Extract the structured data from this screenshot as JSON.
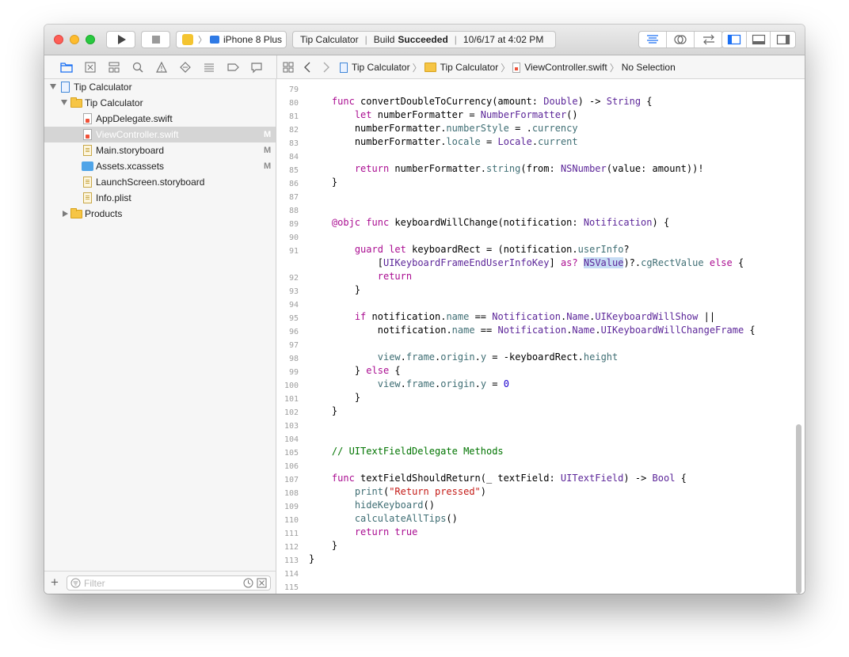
{
  "toolbar": {
    "scheme_device": "iPhone 8 Plus",
    "activity_app": "Tip Calculator",
    "build_prefix": "Build",
    "build_status": "Succeeded",
    "build_time": "10/6/17 at 4:02 PM"
  },
  "colors": {
    "close": "#fe5f57",
    "minimize": "#febc2e",
    "zoom": "#28c840",
    "accent": "#1a6ff4"
  },
  "jumpbar": {
    "crumbs": [
      "Tip Calculator",
      "Tip Calculator",
      "ViewController.swift",
      "No Selection"
    ]
  },
  "navigator": {
    "items": [
      {
        "label": "Tip Calculator",
        "icon": "project-icon",
        "badge": ""
      },
      {
        "label": "Tip Calculator",
        "icon": "folder-icon",
        "badge": ""
      },
      {
        "label": "AppDelegate.swift",
        "icon": "swift-file-icon",
        "badge": ""
      },
      {
        "label": "ViewController.swift",
        "icon": "swift-file-icon",
        "badge": "M"
      },
      {
        "label": "Main.storyboard",
        "icon": "storyboard-file-icon",
        "badge": "M"
      },
      {
        "label": "Assets.xcassets",
        "icon": "assets-icon",
        "badge": "M"
      },
      {
        "label": "LaunchScreen.storyboard",
        "icon": "storyboard-file-icon",
        "badge": ""
      },
      {
        "label": "Info.plist",
        "icon": "plist-file-icon",
        "badge": ""
      },
      {
        "label": "Products",
        "icon": "folder-icon",
        "badge": ""
      }
    ],
    "filter_placeholder": "Filter"
  },
  "editor": {
    "line_numbers": [
      "79",
      "80",
      "81",
      "82",
      "83",
      "84",
      "85",
      "86",
      "87",
      "88",
      "89",
      "90",
      "91",
      "",
      "92",
      "93",
      "94",
      "95",
      "96",
      "97",
      "98",
      "99",
      "100",
      "101",
      "102",
      "103",
      "104",
      "105",
      "106",
      "107",
      "108",
      "109",
      "110",
      "111",
      "112",
      "113",
      "114",
      "115"
    ]
  }
}
